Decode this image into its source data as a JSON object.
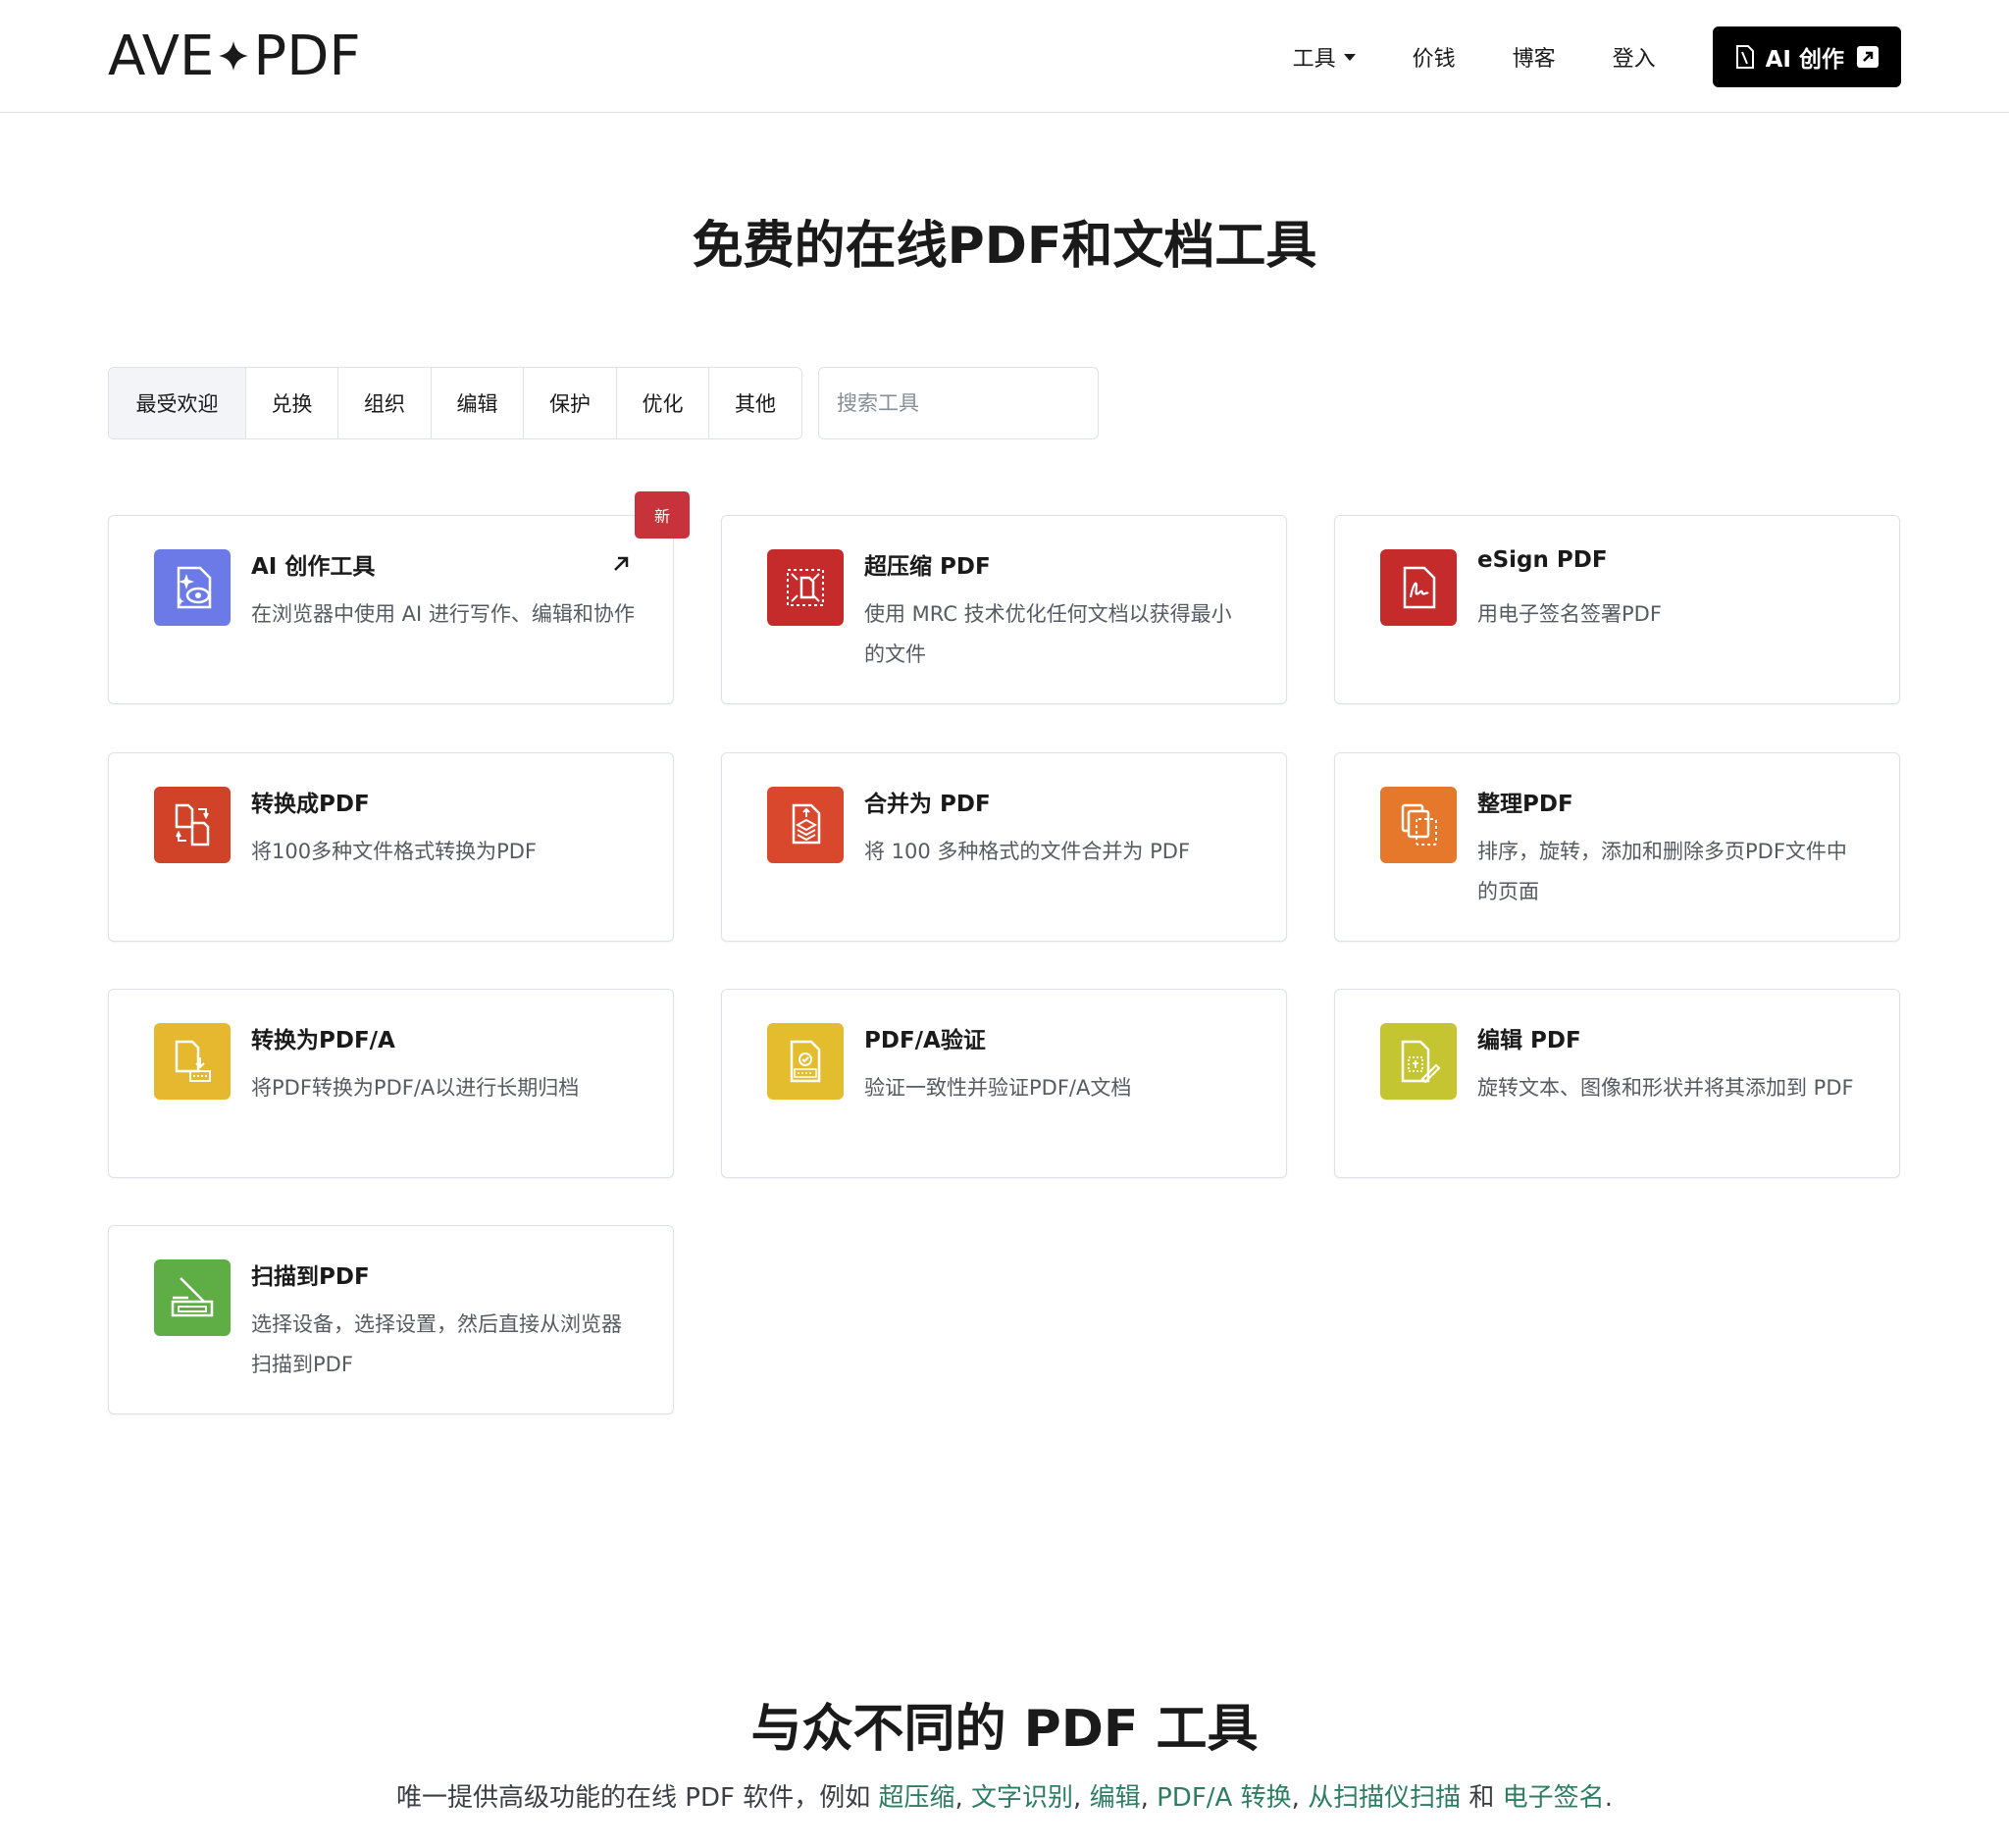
{
  "header": {
    "logo_left": "AVE",
    "logo_right": "PDF",
    "nav": {
      "tools": "工具",
      "pricing": "价钱",
      "blog": "博客",
      "login": "登入",
      "ai_button": "AI 创作"
    }
  },
  "hero": {
    "title": "免费的在线PDF和文档工具"
  },
  "filters": {
    "tabs": [
      "最受欢迎",
      "兑换",
      "组织",
      "编辑",
      "保护",
      "优化",
      "其他"
    ],
    "search_placeholder": "搜索工具"
  },
  "badge_new": "新",
  "cards": [
    {
      "title": "AI 创作工具",
      "desc": "在浏览器中使用 AI 进行写作、编辑和协作",
      "icon": "ai-writer-icon",
      "color": "#6c7ae8"
    },
    {
      "title": "超压缩 PDF",
      "desc": "使用 MRC 技术优化任何文档以获得最小的文件",
      "icon": "compress-icon",
      "color": "#c62b2b"
    },
    {
      "title": "eSign PDF",
      "desc": "用电子签名签署PDF",
      "icon": "esign-icon",
      "color": "#c62b2b"
    },
    {
      "title": "转换成PDF",
      "desc": "将100多种文件格式转换为PDF",
      "icon": "convert-icon",
      "color": "#d04329"
    },
    {
      "title": "合并为 PDF",
      "desc": "将 100 多种格式的文件合并为 PDF",
      "icon": "merge-icon",
      "color": "#d9482d"
    },
    {
      "title": "整理PDF",
      "desc": "排序，旋转，添加和删除多页PDF文件中的页面",
      "icon": "organize-icon",
      "color": "#e5782a"
    },
    {
      "title": "转换为PDF/A",
      "desc": "将PDF转换为PDF/A以进行长期归档",
      "icon": "pdfa-convert-icon",
      "color": "#e6b82f"
    },
    {
      "title": "PDF/A验证",
      "desc": "验证一致性并验证PDF/A文档",
      "icon": "pdfa-validate-icon",
      "color": "#e3bd2e"
    },
    {
      "title": "编辑 PDF",
      "desc": "旋转文本、图像和形状并将其添加到 PDF",
      "icon": "edit-icon",
      "color": "#c4c531"
    },
    {
      "title": "扫描到PDF",
      "desc": "选择设备，选择设置，然后直接从浏览器扫描到PDF",
      "icon": "scanner-icon",
      "color": "#5fae45"
    }
  ],
  "section": {
    "title": "与众不同的 PDF 工具",
    "sub_prefix": "唯一提供高级功能的在线 PDF 软件，例如 ",
    "links": [
      "超压缩",
      "文字识别",
      "编辑",
      "PDF/A 转换",
      "从扫描仪扫描"
    ],
    "and": " 和 ",
    "last_link": "电子签名",
    "sep": ", ",
    "end": "."
  },
  "colors": {
    "accent_link": "#2e7d63",
    "button_bg": "#000000",
    "badge": "#c8333b"
  }
}
